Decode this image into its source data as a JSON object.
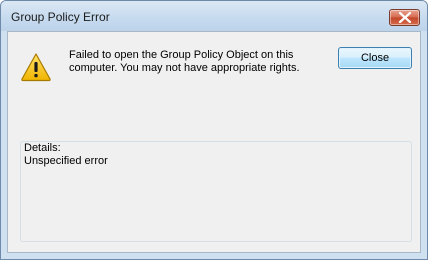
{
  "window": {
    "title": "Group Policy Error"
  },
  "message": {
    "line1": "Failed to open the Group Policy Object on this",
    "line2": "computer.  You may not have appropriate rights."
  },
  "buttons": {
    "close_label": "Close"
  },
  "details": {
    "label": "Details:",
    "text": "Unspecified error"
  },
  "icons": {
    "titlebar_close": "close-icon",
    "message_icon": "warning-icon"
  },
  "colors": {
    "warning_yellow": "#f5c518",
    "close_button_red": "#c2462a"
  }
}
